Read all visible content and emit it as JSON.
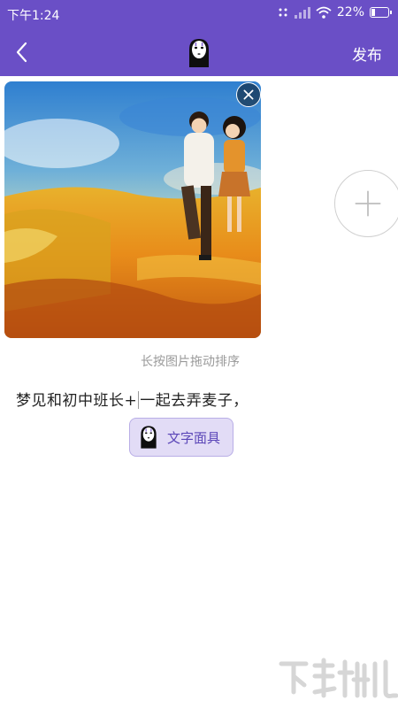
{
  "status_bar": {
    "time": "下午1:24",
    "battery": "22%",
    "battery_level": 0.22
  },
  "nav": {
    "publish_label": "发布",
    "back_icon": "chevron-left-icon",
    "center_icon": "no-face-mask-icon"
  },
  "editor": {
    "remove_icon": "close-circle-icon",
    "add_icon": "plus-circle-icon",
    "sort_hint": "长按图片拖动排序",
    "text_before_cursor": "梦见和初中班长+",
    "text_after_cursor": "一起去弄麦子，",
    "mask_button_label": "文字面具"
  },
  "colors": {
    "header": "#6a4fc6",
    "mask_button_bg": "#e2dcf6",
    "mask_button_text": "#5b46b8"
  }
}
